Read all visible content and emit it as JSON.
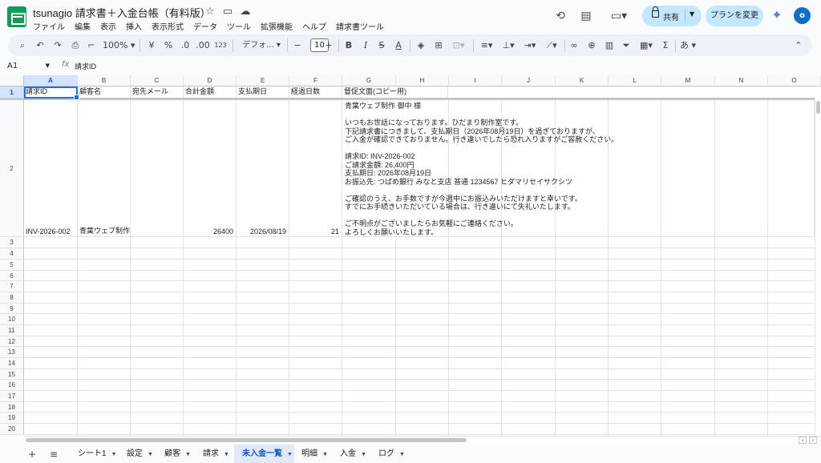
{
  "app": {
    "title": "tsunagio 請求書＋入金台帳（有料版）",
    "menus": [
      "ファイル",
      "編集",
      "表示",
      "挿入",
      "表示形式",
      "データ",
      "ツール",
      "拡張機能",
      "ヘルプ",
      "請求書ツール"
    ],
    "share_label": "共有",
    "plan_label": "プランを変更",
    "avatar_initial": "o"
  },
  "toolbar": {
    "zoom": "100%",
    "currency": "¥",
    "percent": "%",
    "dec_decrease": ".0",
    "dec_increase": ".00",
    "number_format": "123",
    "font_name": "デフォ...",
    "font_size": "10",
    "bold": "B",
    "italic": "I",
    "strike": "S",
    "text_color": "A",
    "ime": "あ"
  },
  "formula": {
    "cell_ref": "A1",
    "fx": "fx",
    "value": "請求ID"
  },
  "grid": {
    "columns": [
      "A",
      "B",
      "C",
      "D",
      "E",
      "F",
      "G",
      "H",
      "I",
      "J",
      "K",
      "L",
      "M",
      "N",
      "O"
    ],
    "rows": [
      "1",
      "2",
      "3",
      "4",
      "5",
      "6",
      "7",
      "8",
      "9",
      "10",
      "11",
      "12",
      "13",
      "14",
      "15",
      "16",
      "17",
      "18",
      "19",
      "20"
    ],
    "headers": [
      "請求ID",
      "顧客名",
      "宛先メール",
      "合計金額",
      "支払期日",
      "経過日数",
      "督促文面(コピー用)"
    ],
    "row2": {
      "invoice_id": "INV-2026-002",
      "customer": "青葉ウェブ制作",
      "email": "",
      "total": "26400",
      "due_date": "2026/08/19",
      "elapsed": "21"
    },
    "memo_lines": [
      "青葉ウェブ制作 御中 様",
      "",
      "いつもお世話になっております。ひだまり制作室です。",
      "下記請求書につきまして、支払期日（2026年08月19日）を過ぎておりますが、",
      "ご入金が確認できておりません。行き違いでしたら恐れ入りますがご容赦ください。",
      "",
      "請求ID: INV-2026-002",
      "ご請求金額: 26,400円",
      "支払期日: 2026年08月19日",
      "お振込先: つばめ銀行 みなと支店 普通 1234567 ヒダマリセイサクシツ",
      "",
      "ご確認のうえ、お手数ですが今週中にお振込みいただけますと幸いです。",
      "すでにお手続きいただいている場合は、行き違いにて失礼いたします。",
      "",
      "ご不明点がございましたらお気軽にご連絡ください。",
      "よろしくお願いいたします。"
    ]
  },
  "sheets": [
    "シート1",
    "設定",
    "顧客",
    "請求",
    "未入金一覧",
    "明細",
    "入金",
    "ログ"
  ],
  "active_sheet": "未入金一覧"
}
